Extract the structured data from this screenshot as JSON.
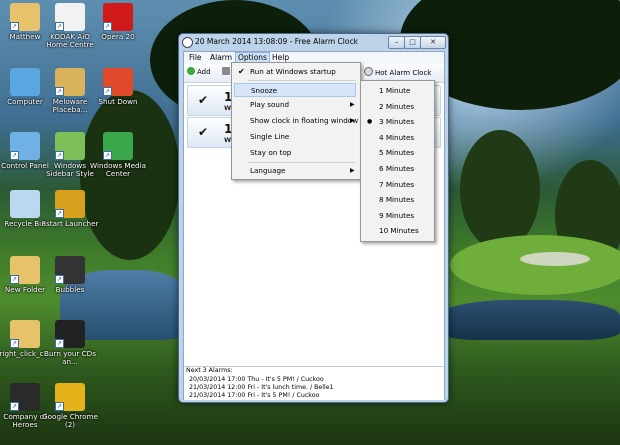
{
  "window": {
    "title": "20 March 2014 13:08:09 - Free Alarm Clock",
    "controls": [
      "minimize",
      "maximize",
      "close"
    ]
  },
  "menubar": [
    {
      "label": "File",
      "active": false
    },
    {
      "label": "Alarm",
      "active": false
    },
    {
      "label": "Options",
      "active": true
    },
    {
      "label": "Help",
      "active": false
    }
  ],
  "toolbar": {
    "add_label": "Add",
    "partial_label": "E",
    "hot_alarm_label": "Hot Alarm Clock"
  },
  "alarms": [
    {
      "time": "12",
      "day": "We",
      "checked": true
    },
    {
      "time": "17",
      "day": "We",
      "checked": true
    }
  ],
  "options_menu": [
    {
      "label": "Run at Windows startup",
      "checked": true,
      "submenu": false
    },
    {
      "label": "Snooze",
      "checked": false,
      "submenu": false,
      "highlighted": true
    },
    {
      "label": "Play sound",
      "checked": false,
      "submenu": true
    },
    {
      "label": "Show clock in floating window",
      "checked": false,
      "submenu": true
    },
    {
      "label": "Single Line",
      "checked": false,
      "submenu": false
    },
    {
      "label": "Stay on top",
      "checked": false,
      "submenu": false
    },
    {
      "label": "Language",
      "checked": false,
      "submenu": true
    }
  ],
  "snooze_menu": [
    {
      "label": "1 Minute",
      "selected": false
    },
    {
      "label": "2 Minutes",
      "selected": false
    },
    {
      "label": "3 Minutes",
      "selected": true
    },
    {
      "label": "4 Minutes",
      "selected": false
    },
    {
      "label": "5 Minutes",
      "selected": false
    },
    {
      "label": "6 Minutes",
      "selected": false
    },
    {
      "label": "7 Minutes",
      "selected": false
    },
    {
      "label": "8 Minutes",
      "selected": false
    },
    {
      "label": "9 Minutes",
      "selected": false
    },
    {
      "label": "10 Minutes",
      "selected": false
    }
  ],
  "next_alarms": {
    "header": "Next 3 Alarms:",
    "lines": [
      "20/03/2014 17:00 Thu - It's 5 PM! / Cuckoo",
      "21/03/2014 12:00 Fri - It's lunch time. / Belle1",
      "21/03/2014 17:00 Fri - It's 5 PM! / Cuckoo"
    ]
  },
  "desktop_icons": [
    {
      "label": "Matthew",
      "icon": "user-folder-icon",
      "color": "#e6c36a"
    },
    {
      "label": "KODAK AiO Home Centre",
      "icon": "kodak-icon",
      "color": "#f2f2f2"
    },
    {
      "label": "Opera 20",
      "icon": "opera-icon",
      "color": "#d11a1a"
    },
    {
      "label": "Computer",
      "icon": "computer-icon",
      "color": "#5aa6e0"
    },
    {
      "label": "Meloware Placeba...",
      "icon": "meloware-icon",
      "color": "#d9b25a"
    },
    {
      "label": "Shut Down",
      "icon": "power-icon",
      "color": "#e04a2a"
    },
    {
      "label": "Control Panel",
      "icon": "control-panel-icon",
      "color": "#6fb0e5"
    },
    {
      "label": "Windows Sidebar Style",
      "icon": "sidebar-icon",
      "color": "#7fbf5a"
    },
    {
      "label": "Windows Media Center",
      "icon": "media-center-icon",
      "color": "#3aa84a"
    },
    {
      "label": "Recycle Bin",
      "icon": "recycle-bin-icon",
      "color": "#bcd8f0"
    },
    {
      "label": "8start Launcher",
      "icon": "launcher-icon",
      "color": "#d9a020"
    },
    {
      "label": "New Folder",
      "icon": "folder-icon",
      "color": "#e6c36a"
    },
    {
      "label": "Bubbles",
      "icon": "bubbles-icon",
      "color": "#333333"
    },
    {
      "label": "right_click_c...",
      "icon": "folder-icon",
      "color": "#e6c36a"
    },
    {
      "label": "Burn your CDs an...",
      "icon": "burn-cd-icon",
      "color": "#222222"
    },
    {
      "label": "Company of Heroes",
      "icon": "game-icon",
      "color": "#2a2a2a"
    },
    {
      "label": "Google Chrome (2)",
      "icon": "chrome-icon",
      "color": "#e5b21a"
    }
  ]
}
